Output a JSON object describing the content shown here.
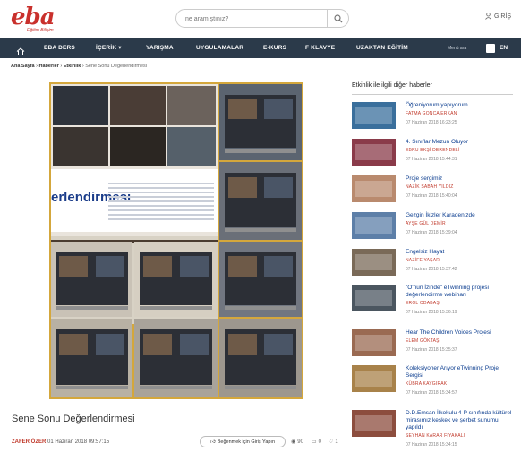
{
  "logo": {
    "text": "eba",
    "tagline": "Eğitim Bilişim"
  },
  "search": {
    "placeholder": "ne aramıştınız?"
  },
  "login_label": "GİRİŞ",
  "nav": {
    "items": [
      "EBA DERS",
      "İÇERİK",
      "YARIŞMA",
      "UYGULAMALAR",
      "E-KURS",
      "F KLAVYE",
      "UZAKTAN EĞİTİM"
    ],
    "more": "Menü ara",
    "lang": "EN"
  },
  "breadcrumb": {
    "home": "Ana Sayfa",
    "l1": "Haberler",
    "l2": "Etkinlik",
    "current": "Sene Sonu Değerlendirmesi"
  },
  "hero": {
    "doc_title": "erlendirmesi"
  },
  "article": {
    "title": "Sene Sonu Değerlendirmesi",
    "author": "ZAFER ÖZER",
    "date": "01 Haziran 2018 09:57:15",
    "like_label": "Beğenmek için Giriş Yapın",
    "views": "90",
    "comments": "0",
    "likes": "1"
  },
  "sidebar": {
    "heading": "Etkinlik ile ilgili diğer haberler",
    "news": [
      {
        "title": "Öğreniyorum yapıyorum",
        "author": "FATMA GONCA ERKAN",
        "date": "07 Haziran 2018 16:23:25",
        "color": "#3a6f9c"
      },
      {
        "title": "4. Sınıflar Mezun Oluyor",
        "author": "EBRU EKŞİ DERENDELİ",
        "date": "07 Haziran 2018 15:44:31",
        "color": "#8a3b4a"
      },
      {
        "title": "Proje sergimiz",
        "author": "NAZİK SABAH YILDIZ",
        "date": "07 Haziran 2018 15:40:04",
        "color": "#b98a6e"
      },
      {
        "title": "Gezgin İkizler Karadenizde",
        "author": "AYŞE GÜL DEMİR",
        "date": "07 Haziran 2018 15:39:04",
        "color": "#5d7fa8"
      },
      {
        "title": "Engelsiz Hayat",
        "author": "NAZİFE YAŞAR",
        "date": "07 Haziran 2018 15:37:42",
        "color": "#7a6a58"
      },
      {
        "title": "\"O'nun İzinde\" eTwinning projesi değerlendirme webinarı",
        "author": "EROL ODABAŞI",
        "date": "07 Haziran 2018 15:36:19",
        "color": "#4b5660"
      },
      {
        "title": "Hear The Children Voices Projesi",
        "author": "ELEM GÖKTAŞ",
        "date": "07 Haziran 2018 15:35:37",
        "color": "#9a6a52"
      },
      {
        "title": "Koleksiyoner Arıyor eTwinning Proje Sergisi",
        "author": "KÜBRA KAYGIRAK",
        "date": "07 Haziran 2018 15:34:57",
        "color": "#a8824a"
      },
      {
        "title": "D.D.Emsan İlkokulu 4-P sınıfında kültürel mirasımız keşkek ve şerbet sunumu yapıldı",
        "author": "SEYHAN KARAR FIYAKALI",
        "date": "07 Haziran 2018 15:34:15",
        "color": "#8c4d3e"
      }
    ]
  }
}
